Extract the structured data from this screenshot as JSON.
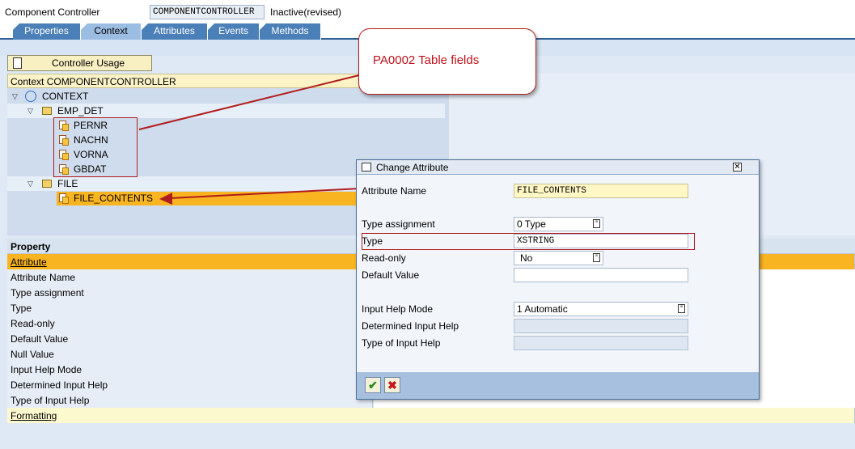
{
  "header": {
    "label": "Component Controller",
    "component_name": "COMPONENTCONTROLLER",
    "status": "Inactive(revised)"
  },
  "tabs": [
    {
      "label": "Properties",
      "active": false
    },
    {
      "label": "Context",
      "active": true
    },
    {
      "label": "Attributes",
      "active": false
    },
    {
      "label": "Events",
      "active": false
    },
    {
      "label": "Methods",
      "active": false
    }
  ],
  "toolbar": {
    "controller_usage_label": "Controller Usage"
  },
  "context": {
    "header": "Context COMPONENTCONTROLLER",
    "root": "CONTEXT",
    "nodes": [
      {
        "name": "EMP_DET",
        "attributes": [
          "PERNR",
          "NACHN",
          "VORNA",
          "GBDAT"
        ]
      },
      {
        "name": "FILE",
        "attributes": [
          "FILE_CONTENTS"
        ]
      }
    ]
  },
  "callout": {
    "text": "PA0002 Table fields"
  },
  "properties": {
    "header": "Property",
    "rows": [
      {
        "label": "Attribute",
        "link": true,
        "highlight": "orange"
      },
      {
        "label": "Attribute Name"
      },
      {
        "label": "Type assignment"
      },
      {
        "label": "Type"
      },
      {
        "label": "Read-only"
      },
      {
        "label": "Default Value"
      },
      {
        "label": "Null Value"
      },
      {
        "label": "Input Help Mode"
      },
      {
        "label": "Determined Input Help"
      },
      {
        "label": "Type of Input Help"
      },
      {
        "label": "Formatting",
        "link": true,
        "highlight": "yellow"
      }
    ]
  },
  "dialog": {
    "title": "Change Attribute",
    "fields": {
      "attribute_name": {
        "label": "Attribute Name",
        "value": "FILE_CONTENTS"
      },
      "type_assignment": {
        "label": "Type assignment",
        "value": "0 Type"
      },
      "type": {
        "label": "Type",
        "value": "XSTRING"
      },
      "read_only": {
        "label": "Read-only",
        "value": "No"
      },
      "default_value": {
        "label": "Default Value",
        "value": ""
      },
      "input_help_mode": {
        "label": "Input Help Mode",
        "value": "1 Automatic"
      },
      "determined_input_help": {
        "label": "Determined Input Help",
        "value": ""
      },
      "type_of_input_help": {
        "label": "Type of Input Help",
        "value": ""
      }
    },
    "ok_icon": "checkmark-icon",
    "cancel_icon": "cancel-x-icon"
  },
  "colors": {
    "accent_red": "#b01d1d",
    "selection_orange": "#f9b421",
    "tab_blue": "#4b7fb8"
  }
}
